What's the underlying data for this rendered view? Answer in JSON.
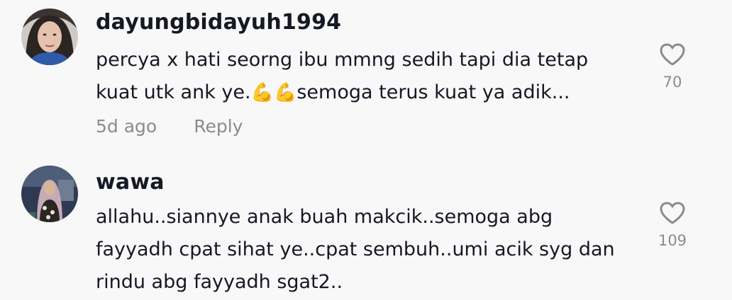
{
  "comments": [
    {
      "username": "dayungbidayuh1994",
      "text_before_emoji": "percya x hati seorng ibu mmng sedih tapi dia tetap kuat utk ank ye.",
      "emoji": "💪💪",
      "text_after_emoji": "semoga terus kuat ya adik...",
      "time": "5d ago",
      "reply_label": "Reply",
      "likes": "70",
      "like_icon": "heart-outline-icon"
    },
    {
      "username": "wawa",
      "text": "allahu..siannye anak buah makcik..semoga abg fayyadh cpat sihat ye..cpat sembuh..umi acik syg dan rindu abg fayyadh sgat2..",
      "likes": "109",
      "like_icon": "heart-outline-icon"
    }
  ]
}
